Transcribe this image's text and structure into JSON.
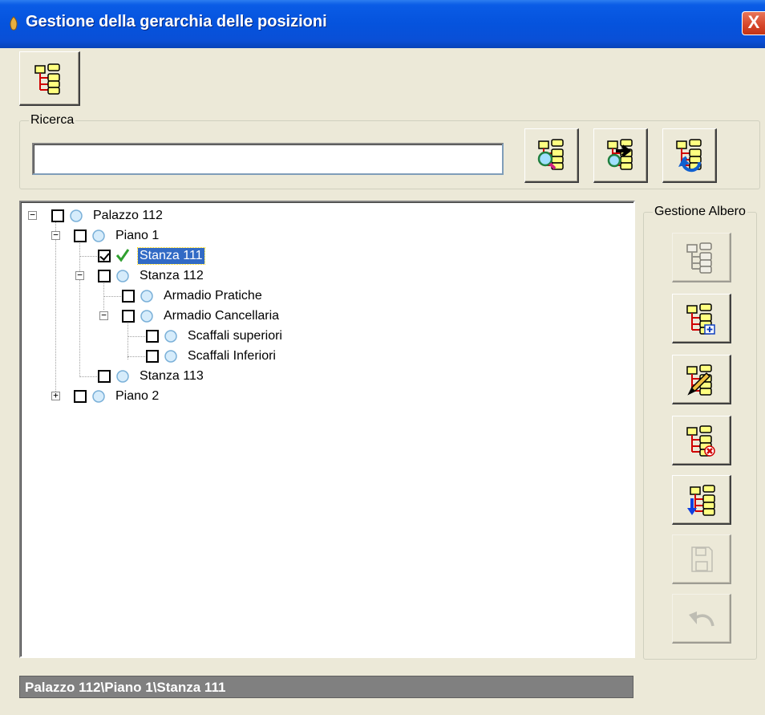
{
  "window": {
    "title": "Gestione della gerarchia delle posizioni",
    "close_label": "X"
  },
  "toolbar": {
    "hierarchy_icon": "folder-tree-icon"
  },
  "search": {
    "group_label": "Ricerca",
    "value": "",
    "placeholder": "",
    "buttons": [
      "search-tree-icon",
      "search-next-icon",
      "search-reset-icon"
    ]
  },
  "tree": {
    "nodes": [
      {
        "label": "Palazzo 112",
        "checked": false,
        "expander": "⊟"
      },
      {
        "label": "Piano 1",
        "checked": false,
        "expander": "⊟"
      },
      {
        "label": "Stanza 111",
        "checked": true,
        "selected": true
      },
      {
        "label": "Stanza 112",
        "checked": false,
        "expander": "⊟"
      },
      {
        "label": "Armadio Pratiche",
        "checked": false
      },
      {
        "label": "Armadio Cancellaria",
        "checked": false,
        "expander": "⊟"
      },
      {
        "label": "Scaffali superiori",
        "checked": false
      },
      {
        "label": "Scaffali Inferiori",
        "checked": false
      },
      {
        "label": "Stanza 113",
        "checked": false
      },
      {
        "label": "Piano 2",
        "checked": false,
        "expander": "⊞"
      }
    ]
  },
  "management": {
    "group_label": "Gestione Albero",
    "buttons": [
      {
        "icon": "tree-expand-icon",
        "enabled": false
      },
      {
        "icon": "tree-add-node-icon",
        "enabled": true
      },
      {
        "icon": "tree-edit-node-icon",
        "enabled": true
      },
      {
        "icon": "tree-delete-node-icon",
        "enabled": true
      },
      {
        "icon": "tree-move-down-icon",
        "enabled": true
      },
      {
        "icon": "save-icon",
        "enabled": false
      },
      {
        "icon": "undo-icon",
        "enabled": false
      }
    ]
  },
  "status": {
    "path": "Palazzo 112\\Piano 1\\Stanza 111"
  },
  "colors": {
    "titlebar": "#0553dd",
    "selection": "#316ac5",
    "window_bg": "#ece9d8",
    "status_bg": "#808080"
  }
}
